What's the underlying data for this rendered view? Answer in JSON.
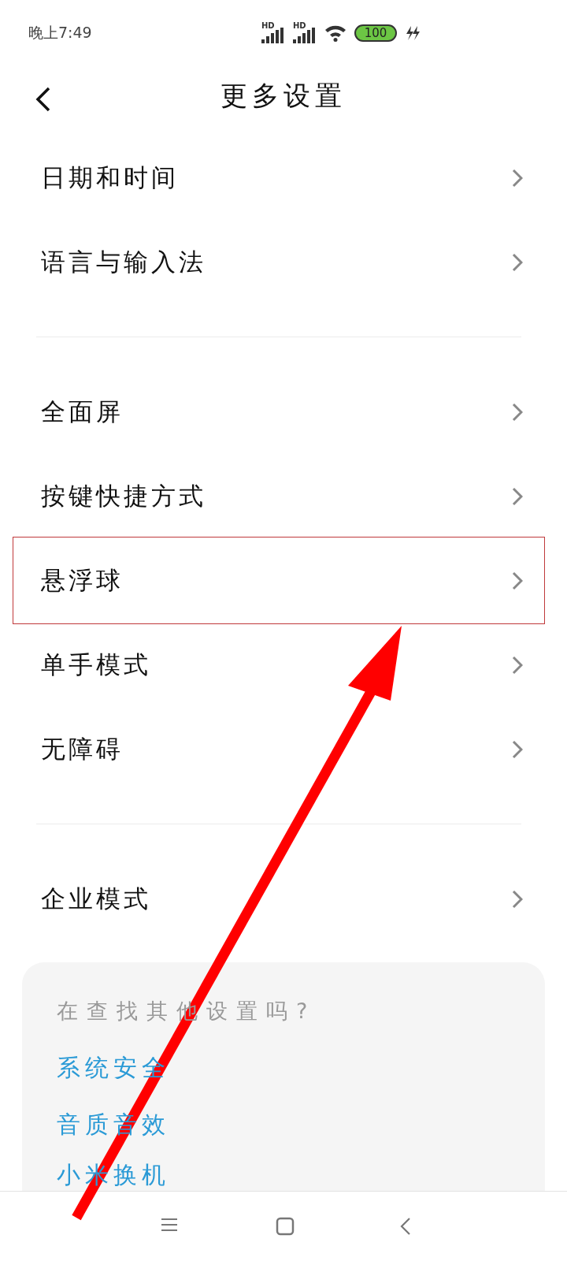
{
  "status_bar": {
    "time": "晚上7:49",
    "signal_labels": [
      "HD",
      "HD"
    ],
    "battery": "100",
    "charging": true
  },
  "header": {
    "title": "更多设置"
  },
  "groups": [
    [
      {
        "label": "日期和时间",
        "highlighted": false
      },
      {
        "label": "语言与输入法",
        "highlighted": false
      }
    ],
    [
      {
        "label": "全面屏",
        "highlighted": false
      },
      {
        "label": "按键快捷方式",
        "highlighted": false
      },
      {
        "label": "悬浮球",
        "highlighted": true
      },
      {
        "label": "单手模式",
        "highlighted": false
      },
      {
        "label": "无障碍",
        "highlighted": false
      }
    ],
    [
      {
        "label": "企业模式",
        "highlighted": false
      }
    ]
  ],
  "suggestions": {
    "title": "在查找其他设置吗?",
    "links": [
      "系统安全",
      "音质音效",
      "小米换机"
    ]
  },
  "annotation": {
    "arrow": true
  }
}
